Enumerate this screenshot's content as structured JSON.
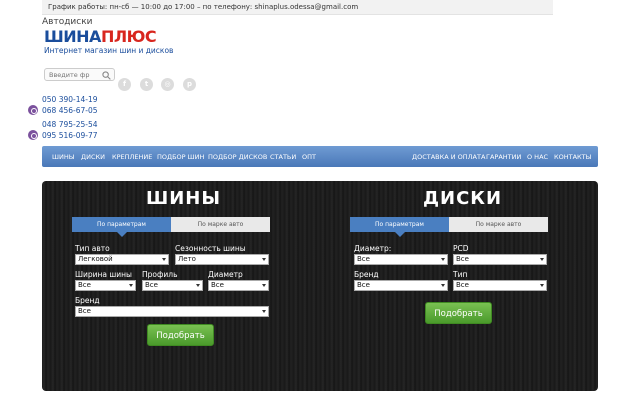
{
  "topbar": {
    "schedule": "График работы: пн-сб — 10:00 до 17:00 – по телефону: shinaplus.odessa@gmail.com"
  },
  "header": {
    "site_title": "Автодиски",
    "logo_part1": "ШИНА",
    "logo_part2": "ПЛЮС",
    "tagline": "Интернет магазин шин и дисков"
  },
  "search": {
    "placeholder": "Введите фр"
  },
  "social": [
    {
      "icon": "facebook-icon",
      "glyph": "f"
    },
    {
      "icon": "twitter-icon",
      "glyph": "t"
    },
    {
      "icon": "instagram-icon",
      "glyph": "◎"
    },
    {
      "icon": "pinterest-icon",
      "glyph": "p"
    }
  ],
  "phones": [
    "050 390-14-19",
    "068 456-67-05",
    "048 795-25-54",
    "095 516-09-77"
  ],
  "nav": {
    "left": [
      "Шины",
      "Диски",
      "Крепление",
      "Подбор шин",
      "Подбор дисков",
      "Статьи",
      "Опт"
    ],
    "right": [
      "Доставка и оплата",
      "Гарантии",
      "О нас",
      "Контакты"
    ]
  },
  "tires": {
    "title": "ШИНЫ",
    "tab_params": "По параметрам",
    "tab_brand": "По марке авто",
    "car_type_label": "Тип авто",
    "car_type_value": "Легковой",
    "season_label": "Сезонность шины",
    "season_value": "Лето",
    "width_label": "Ширина шины",
    "width_value": "Все",
    "profile_label": "Профиль",
    "profile_value": "Все",
    "diameter_label": "Диаметр",
    "diameter_value": "Все",
    "brand_label": "Бренд",
    "brand_value": "Все",
    "submit": "Подобрать"
  },
  "discs": {
    "title": "ДИСКИ",
    "tab_params": "По параметрам",
    "tab_brand": "По марке авто",
    "diameter_label": "Диаметр:",
    "diameter_value": "Все",
    "pcd_label": "PCD",
    "pcd_value": "Все",
    "brand_label": "Бренд",
    "brand_value": "Все",
    "type_label": "Тип",
    "type_value": "Все",
    "submit": "Подобрать"
  },
  "colors": {
    "nav": "#5a88c6",
    "accent_red": "#d8261e",
    "accent_blue": "#1a4d9c",
    "button_green": "#5aad3a",
    "viber": "#7b519d"
  }
}
